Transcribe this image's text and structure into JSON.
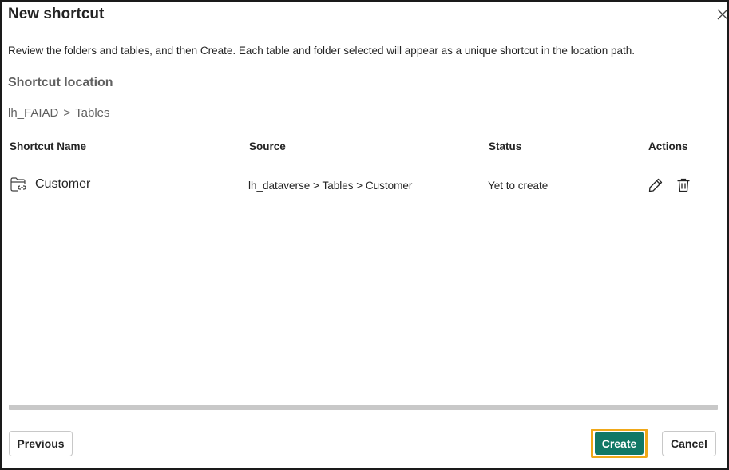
{
  "dialog": {
    "title": "New shortcut",
    "description": "Review the folders and tables, and then Create. Each table and folder selected will appear as a unique shortcut in the location path.",
    "section_label": "Shortcut location",
    "breadcrumb": [
      "lh_FAIAD",
      ">",
      "Tables"
    ]
  },
  "table": {
    "headers": {
      "name": "Shortcut Name",
      "source": "Source",
      "status": "Status",
      "actions": "Actions"
    },
    "rows": [
      {
        "name": "Customer",
        "source": "lh_dataverse > Tables > Customer",
        "status": "Yet to create",
        "icon": "folder-shortcut-icon"
      }
    ]
  },
  "footer": {
    "previous_label": "Previous",
    "create_label": "Create",
    "cancel_label": "Cancel"
  },
  "colors": {
    "primary": "#117865",
    "highlight": "#f0a818",
    "muted_text": "#616161"
  }
}
